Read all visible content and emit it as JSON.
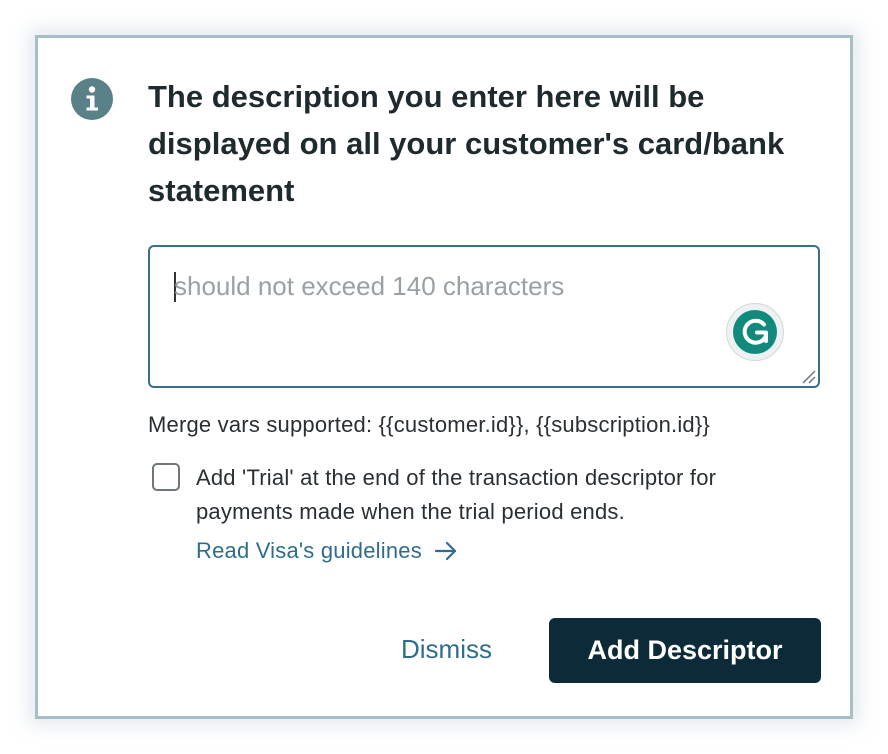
{
  "dialog": {
    "info_icon": "info-icon",
    "title": "The description you enter here will be displayed on all your customer's card/bank statement",
    "descriptor_input": {
      "value": "",
      "placeholder": "should not exceed 140 characters",
      "assistant_icon": "grammarly-icon"
    },
    "merge_vars_text": "Merge vars supported: {{customer.id}}, {{subscription.id}}",
    "trial_checkbox": {
      "checked": false,
      "label": "Add 'Trial' at the end of the transaction descriptor for payments made when the trial period ends."
    },
    "visa_link": {
      "label": "Read Visa's guidelines",
      "icon": "arrow-right-icon"
    },
    "buttons": {
      "dismiss": "Dismiss",
      "add_descriptor": "Add Descriptor"
    }
  },
  "colors": {
    "primary_button": "#0d2a38",
    "link": "#2f6d8c",
    "info_icon": "#5a8088",
    "grammarly": "#118a7d",
    "input_border": "#3a6f8c"
  }
}
